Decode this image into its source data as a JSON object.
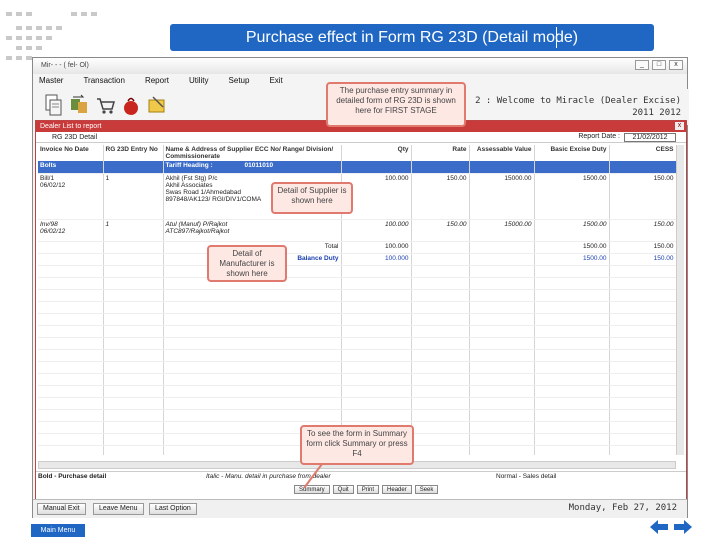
{
  "slide": {
    "title": "Purchase effect in Form RG 23D (Detail mode)",
    "main_menu_label": "Main Menu"
  },
  "window": {
    "title": "Mir- - - ( fel- Ol)",
    "controls": [
      "_",
      "□",
      "x"
    ]
  },
  "menu": [
    "Master",
    "Transaction",
    "Report",
    "Utility",
    "Setup",
    "Exit"
  ],
  "toolbar": {
    "icons": [
      "document-icon",
      "transfer-icon",
      "cart-icon",
      "bag-icon",
      "folder-icon"
    ]
  },
  "welcome": {
    "line1": "2 : Welcome to Miracle (Dealer Excise)",
    "line2": "2011  2012"
  },
  "report": {
    "window_title": "Dealer List to report",
    "subtitle": "RG 23D Detail",
    "report_date_label": "Report Date :",
    "report_date": "21/02/2012",
    "columns": {
      "invoice": "Invoice No Date",
      "entry": "RG 23D Entry No",
      "supplier": "Name & Address of Supplier ECC No/ Range/ Division/ Commissionerate",
      "qty": "Qty",
      "rate": "Rate",
      "assessable": "Assessable Value",
      "basic_duty": "Basic Excise Duty",
      "cess": "CESS"
    },
    "highlight_row": {
      "item": "Bolts",
      "tariff_label": "Tariff Heading :",
      "tariff": "01011010"
    },
    "rows": [
      {
        "invoice": "Bill/1",
        "date": "06/02/12",
        "entry": "1",
        "supplier": [
          "Akhil (Fst Stg) P/c",
          "Akhil Associates",
          "Swas Road 1/Ahmedabad",
          "897848/AK123/ RGI/DIV1/COMA"
        ],
        "qty": "100.000",
        "rate": "150.00",
        "assessable": "15000.00",
        "basic_duty": "1500.00",
        "cess": "150.00"
      },
      {
        "invoice": "Inv/98",
        "date": "06/02/12",
        "entry": "1",
        "supplier": [
          "Atul (Manuf) P/Rajkot",
          "ATC897/Rajkot/Rajkot"
        ],
        "qty": "100.000",
        "rate": "150.00",
        "assessable": "15000.00",
        "basic_duty": "1500.00",
        "cess": "150.00"
      }
    ],
    "total": {
      "label": "Total",
      "qty": "100.000",
      "basic_duty": "1500.00",
      "cess": "150.00"
    },
    "balance": {
      "label": "Balance Duty",
      "qty": "100.000",
      "basic_duty": "1500.00",
      "cess": "150.00"
    },
    "status_left": "Bold - Purchase detail",
    "status_mid": "Italic - Manu. detail in purchase from dealer",
    "status_right": "Normal - Sales detail",
    "buttons": [
      "Summary",
      "Quit",
      "Print",
      "Header",
      "Seek"
    ]
  },
  "bottom_bar": {
    "buttons": [
      "Manual Exit",
      "Leave Menu",
      "Last Option"
    ],
    "date": "Monday, Feb 27, 2012"
  },
  "callouts": {
    "first_stage": "The purchase entry summary in detailed form of RG 23D is shown here for FIRST STAGE",
    "supplier": "Detail of Supplier is shown here",
    "manufacturer": "Detail of Manufacturer is shown here",
    "summary": "To see the form in Summary form click Summary or press F4"
  },
  "colors": {
    "banner": "#1f67c3",
    "report_title": "#c93a3a",
    "highlight_row": "#3b6cc9",
    "callout_fill": "#fde8e4",
    "callout_border": "#e07a6e"
  }
}
